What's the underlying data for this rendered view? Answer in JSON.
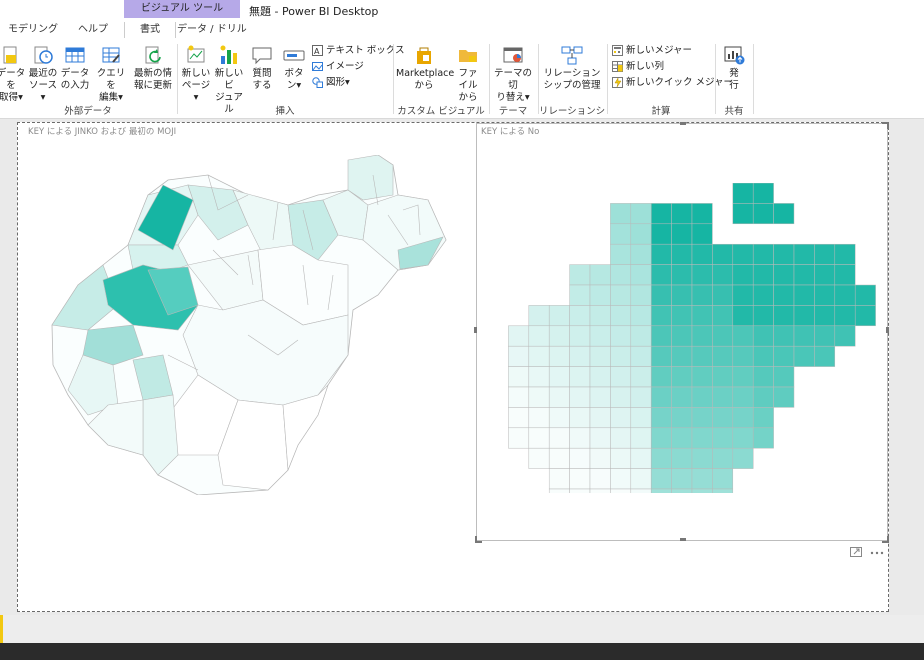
{
  "window": {
    "title": "無題 - Power BI Desktop"
  },
  "context_tab": {
    "label": "ビジュアル ツール"
  },
  "tabs": [
    {
      "label": "モデリング"
    },
    {
      "label": "ヘルプ"
    },
    {
      "label": "書式"
    },
    {
      "label": "データ / ドリル"
    }
  ],
  "ribbon": {
    "groups": {
      "external_data": "外部データ",
      "insert": "挿入",
      "custom_visual": "カスタム ビジュアル",
      "theme": "テーマ",
      "relationship": "リレーションシップ",
      "calculation": "計算",
      "share": "共有"
    },
    "buttons": {
      "get_data": [
        "データを",
        "取得▾"
      ],
      "recent_sources": [
        "最近の",
        "ソース▾"
      ],
      "enter_data": [
        "データ",
        "の入力"
      ],
      "edit_queries": [
        "クエリを",
        "編集▾"
      ],
      "refresh": [
        "最新の情",
        "報に更新"
      ],
      "new_page": [
        "新しい",
        "ページ▾"
      ],
      "new_visual": [
        "新しいビ",
        "ジュアル"
      ],
      "ask_question": [
        "質問",
        "する"
      ],
      "buttons": [
        "ボタ",
        "ン▾"
      ],
      "textbox": "テキスト ボックス",
      "image": "イメージ",
      "shapes": "図形▾",
      "marketplace": [
        "Marketplace",
        "から"
      ],
      "from_file": [
        "ファイル",
        "から"
      ],
      "switch_theme": [
        "テーマの切",
        "り替え▾"
      ],
      "manage_relationships": [
        "リレーション",
        "シップの管理"
      ],
      "new_measure": "新しいメジャー",
      "new_column": "新しい列",
      "new_quick_measure": "新しいクイック メジャー",
      "publish": [
        "発",
        "行"
      ]
    }
  },
  "visuals": {
    "left_title": "KEY による JINKO および 最初の MOJI",
    "right_title": "KEY による No"
  },
  "colors": {
    "accent": "#16b5a3",
    "context_tab": "#b6a9e8",
    "status_mark": "#f2c811"
  }
}
